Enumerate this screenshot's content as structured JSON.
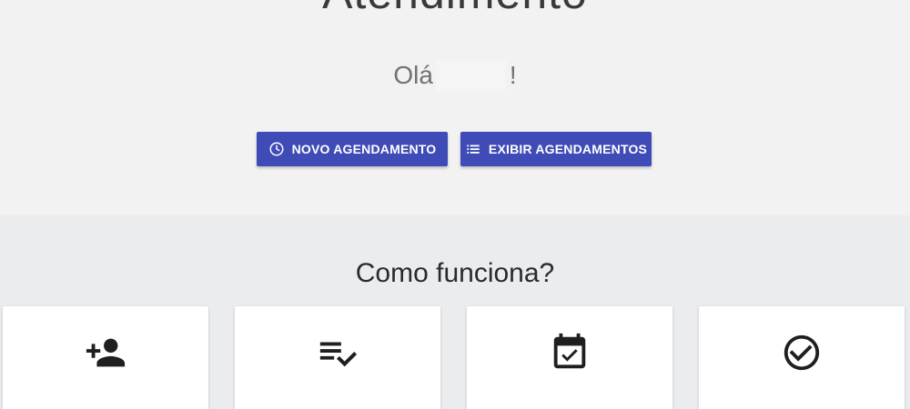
{
  "hero": {
    "title": "Atendimento",
    "greeting_prefix": "Olá",
    "greeting_suffix": "!"
  },
  "actions": {
    "new_label": "NOVO AGENDAMENTO",
    "new_icon": "clock-icon",
    "list_label": "EXIBIR AGENDAMENTOS",
    "list_icon": "list-icon"
  },
  "how_it_works": {
    "title": "Como funciona?",
    "cards": [
      {
        "icon": "person-add-icon"
      },
      {
        "icon": "playlist-check-icon"
      },
      {
        "icon": "calendar-check-icon"
      },
      {
        "icon": "check-circle-icon"
      }
    ]
  },
  "colors": {
    "primary": "#3f4cb7",
    "hero_background": "#f2f2f2",
    "page_background": "#ebecee"
  }
}
